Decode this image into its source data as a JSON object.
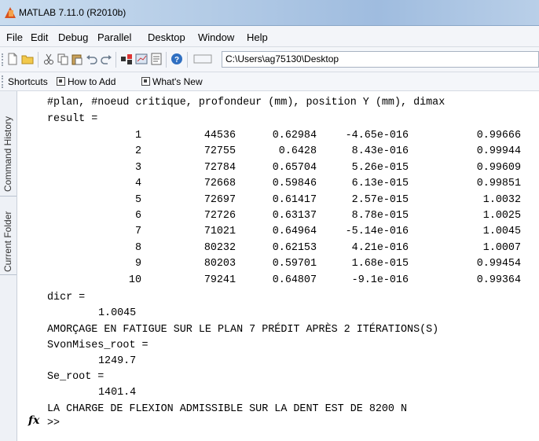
{
  "window": {
    "title": "MATLAB  7.11.0 (R2010b)"
  },
  "menu": [
    "File",
    "Edit",
    "Debug",
    "Parallel",
    "Desktop",
    "Window",
    "Help"
  ],
  "toolbar": {
    "current_folder": "C:\\Users\\ag75130\\Desktop",
    "icons": [
      "new-file-icon",
      "open-folder-icon",
      "cut-icon",
      "copy-icon",
      "paste-icon",
      "undo-icon",
      "redo-icon",
      "simulink-icon",
      "guide-icon",
      "profiler-icon",
      "help-icon"
    ]
  },
  "shortcuts": {
    "prefix": "Shortcuts",
    "items": [
      "How to Add",
      "What's New"
    ]
  },
  "side_tabs": [
    "Command History",
    "Current Folder"
  ],
  "console": {
    "header_line": "#plan, #noeud critique, profondeur (mm), position Y (mm), dimax",
    "result_label": "result =",
    "table": [
      [
        "1",
        "44536",
        "0.62984",
        "-4.65e-016",
        "0.99666"
      ],
      [
        "2",
        "72755",
        "0.6428",
        "8.43e-016",
        "0.99944"
      ],
      [
        "3",
        "72784",
        "0.65704",
        "5.26e-015",
        "0.99609"
      ],
      [
        "4",
        "72668",
        "0.59846",
        "6.13e-015",
        "0.99851"
      ],
      [
        "5",
        "72697",
        "0.61417",
        "2.57e-015",
        "1.0032"
      ],
      [
        "6",
        "72726",
        "0.63137",
        "8.78e-015",
        "1.0025"
      ],
      [
        "7",
        "71021",
        "0.64964",
        "-5.14e-016",
        "1.0045"
      ],
      [
        "8",
        "80232",
        "0.62153",
        "4.21e-016",
        "1.0007"
      ],
      [
        "9",
        "80203",
        "0.59701",
        "1.68e-015",
        "0.99454"
      ],
      [
        "10",
        "79241",
        "0.64807",
        "-9.1e-016",
        "0.99364"
      ]
    ],
    "dicr_label": "dicr =",
    "dicr_value": "1.0045",
    "fatigue_msg": "AMORÇAGE EN FATIGUE SUR LE PLAN 7 PRÉDIT APRÈS 2 ITÉRATIONS(S)",
    "svm_label": "SvonMises_root =",
    "svm_value": "1249.7",
    "se_label": "Se_root =",
    "se_value": "1401.4",
    "charge_msg": "LA CHARGE DE FLEXION ADMISSIBLE SUR LA DENT EST DE 8200 N",
    "prompt": ">>",
    "fx_label": "fx"
  }
}
